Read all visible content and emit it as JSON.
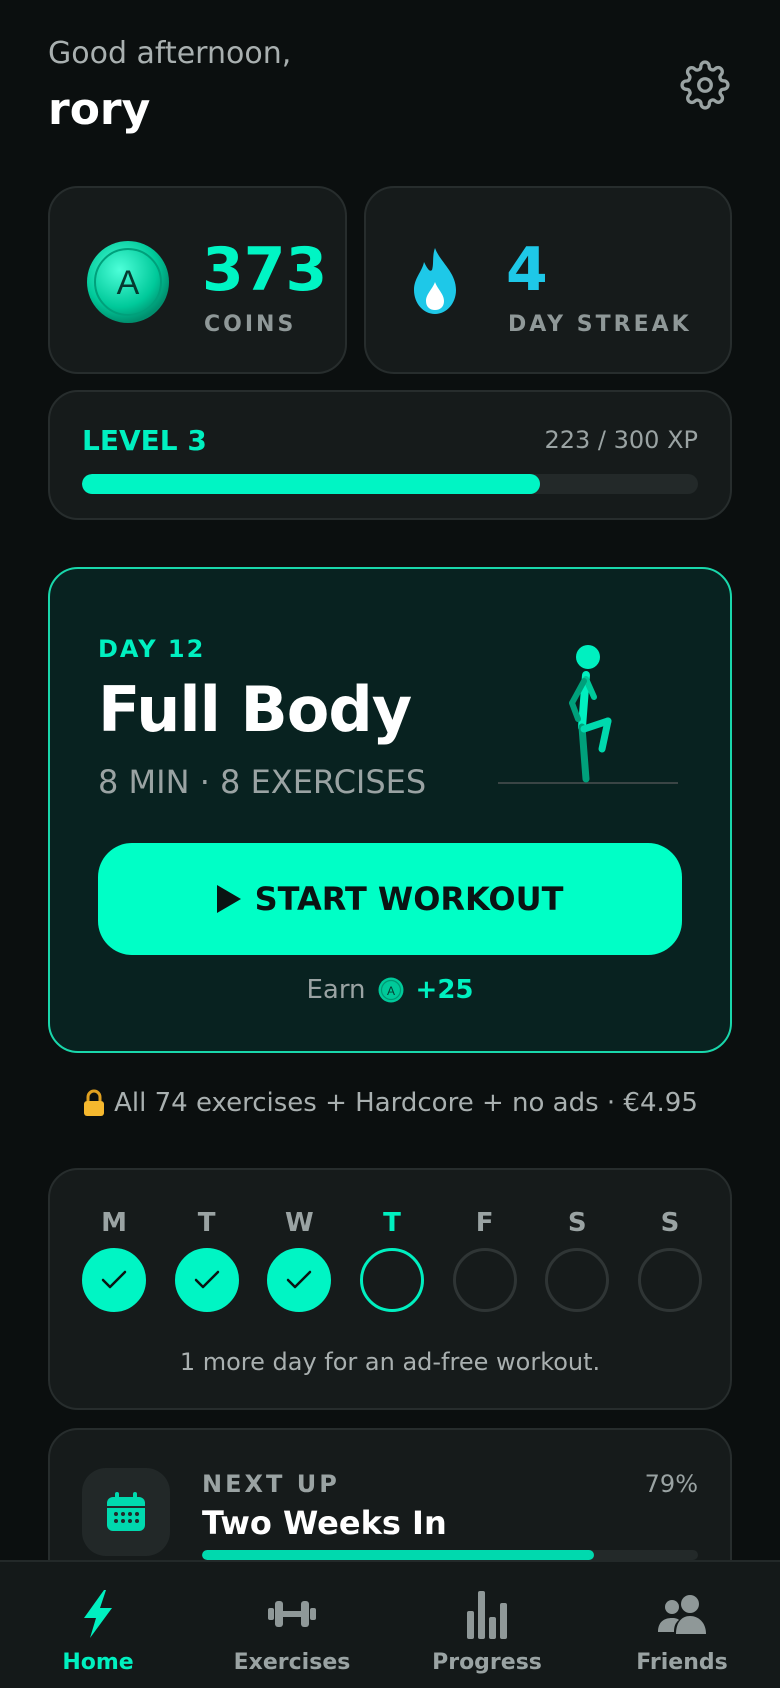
{
  "header": {
    "greeting": "Good afternoon,",
    "username": "rory",
    "settings_icon": "gear-icon"
  },
  "stats": {
    "coins": {
      "value": "373",
      "label": "COINS",
      "icon": "coin-icon",
      "coin_letter": "A"
    },
    "streak": {
      "value": "4",
      "label": "DAY STREAK",
      "icon": "flame-icon"
    }
  },
  "level": {
    "title": "LEVEL 3",
    "xp_text": "223 / 300 XP",
    "progress": 0.743
  },
  "workout": {
    "day_label": "DAY 12",
    "title": "Full Body",
    "meta": "8 MIN · 8 EXERCISES",
    "start_label": "START WORKOUT",
    "earn_label": "Earn",
    "earn_value": "+25"
  },
  "upsell": {
    "icon": "lock-icon",
    "text": "All 74 exercises + Hardcore + no ads · €4.95"
  },
  "week": {
    "days": [
      {
        "letter": "M",
        "state": "done"
      },
      {
        "letter": "T",
        "state": "done"
      },
      {
        "letter": "W",
        "state": "done"
      },
      {
        "letter": "T",
        "state": "today"
      },
      {
        "letter": "F",
        "state": "empty"
      },
      {
        "letter": "S",
        "state": "empty"
      },
      {
        "letter": "S",
        "state": "empty"
      }
    ],
    "note": "1 more day for an ad-free workout."
  },
  "next_up": {
    "label": "NEXT UP",
    "title": "Two Weeks In",
    "percent": "79%",
    "progress": 0.79,
    "icon": "calendar-icon"
  },
  "nav": {
    "items": [
      {
        "label": "Home",
        "icon": "lightning-icon",
        "active": true
      },
      {
        "label": "Exercises",
        "icon": "dumbbell-icon",
        "active": false
      },
      {
        "label": "Progress",
        "icon": "bar-chart-icon",
        "active": false
      },
      {
        "label": "Friends",
        "icon": "people-icon",
        "active": false
      }
    ]
  },
  "colors": {
    "accent": "#00f5c4",
    "streak": "#1ec8e8",
    "background": "#0b0f0f",
    "card": "#161b1b",
    "lock": "#f5b82e"
  }
}
